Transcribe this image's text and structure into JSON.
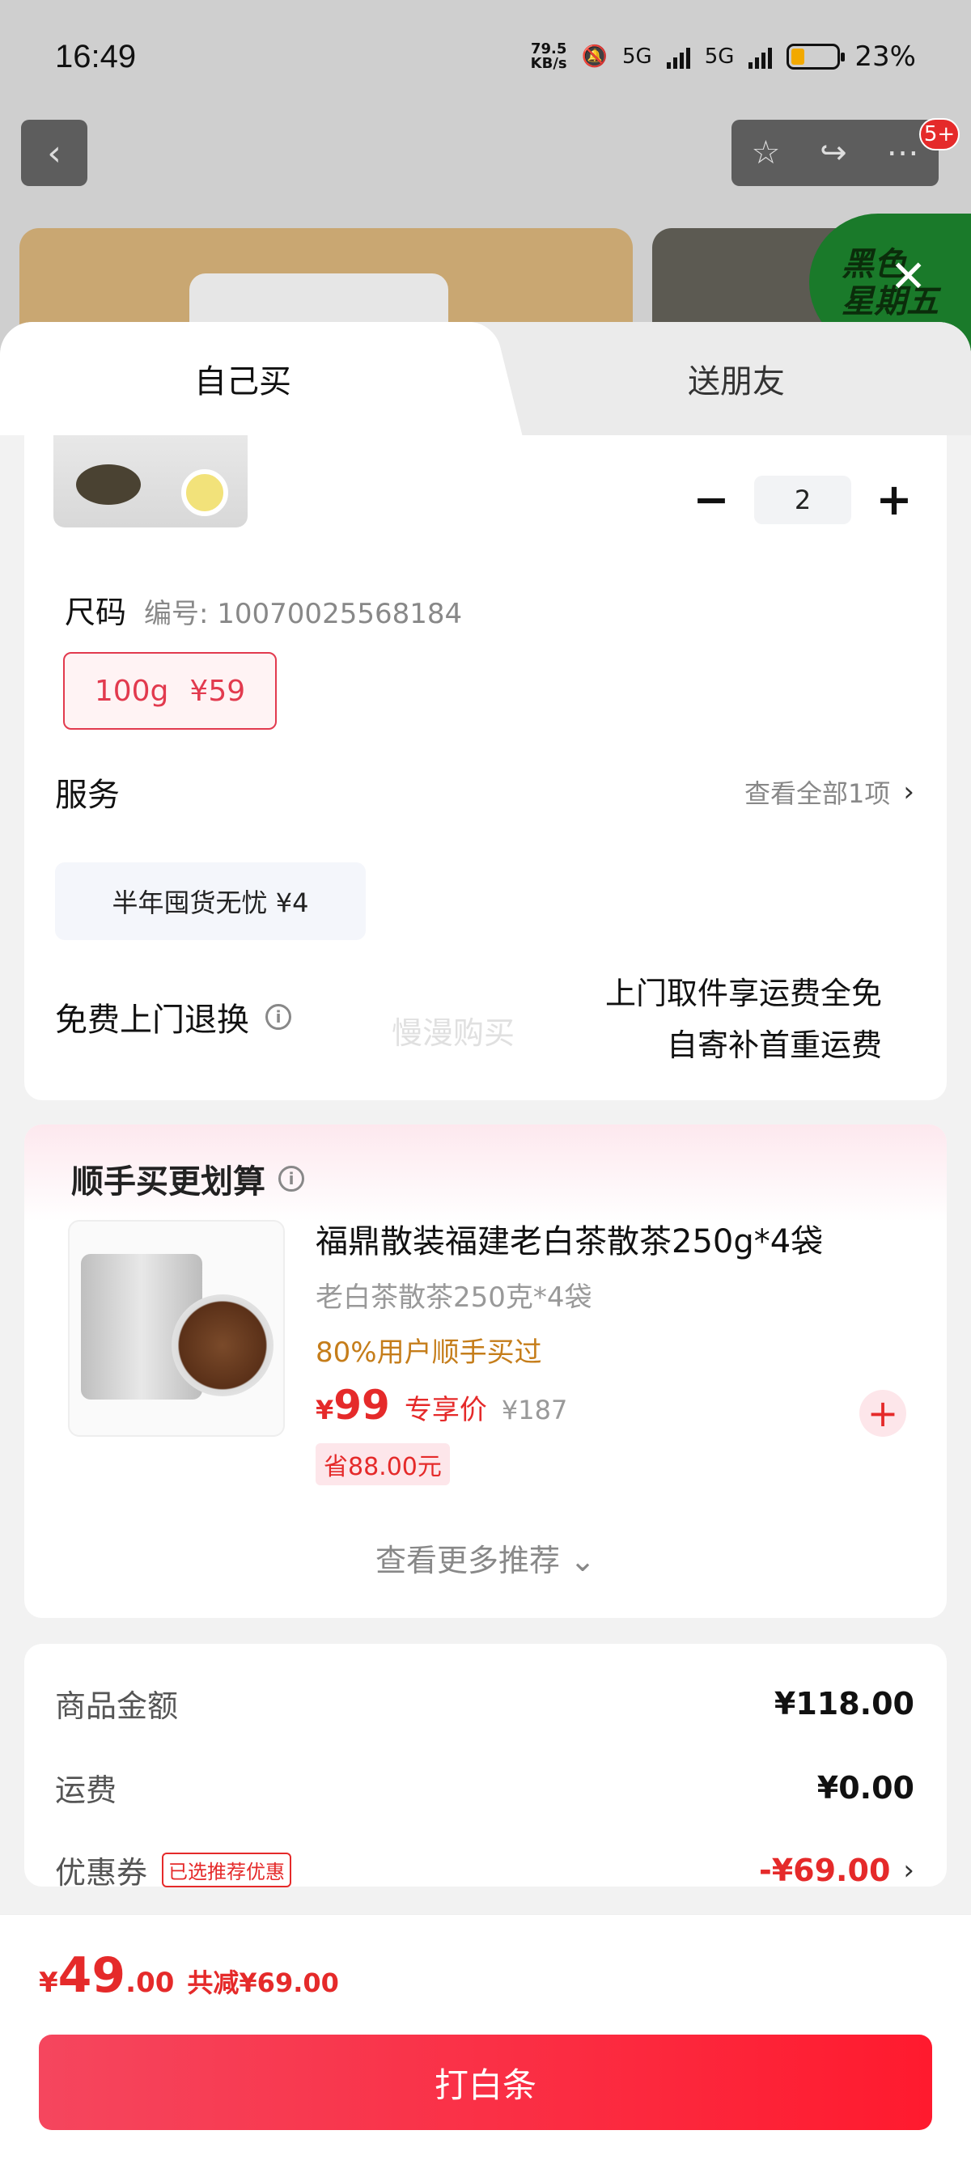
{
  "status": {
    "time": "16:49",
    "net_speed_value": "79.5",
    "net_speed_unit": "KB/s",
    "net1": "5G",
    "net2": "5G",
    "battery": "23%"
  },
  "nav": {
    "back_icon": "chevron-left-icon",
    "badge": "5+"
  },
  "promo": {
    "text_line1": "黑色",
    "text_line2": "星期五"
  },
  "tabs": {
    "self": "自己买",
    "friend": "送朋友"
  },
  "product": {
    "quantity": "2"
  },
  "size": {
    "label": "尺码",
    "code": "编号: 10070025568184",
    "option_weight": "100g",
    "option_price": "¥59"
  },
  "service": {
    "title": "服务",
    "view_all": "查看全部1项",
    "chip": "半年囤货无忧  ¥4"
  },
  "returns": {
    "title": "免费上门退换",
    "line1": "上门取件享运费全免",
    "line2": "自寄补首重运费",
    "watermark": "慢漫购买"
  },
  "recommend": {
    "title": "顺手买更划算",
    "name": "福鼎散装福建老白茶散茶250g*4袋",
    "subtitle": "老白茶散茶250克*4袋",
    "stat": "80%用户顺手买过",
    "price_symbol": "¥",
    "price": "99",
    "price_tag": "专享价",
    "original": "¥187",
    "save": "省88.00元",
    "more": "查看更多推荐 ⌄"
  },
  "summary": {
    "goods_label": "商品金额",
    "goods_value": "¥118.00",
    "shipping_label": "运费",
    "shipping_value": "¥0.00",
    "coupon_label": "优惠券",
    "coupon_tag": "已选推荐优惠",
    "coupon_value": "-¥69.00"
  },
  "footer": {
    "currency": "¥",
    "total_int": "49",
    "total_dec": ".00",
    "reduced": "共减¥69.00",
    "pay_button": "打白条"
  }
}
